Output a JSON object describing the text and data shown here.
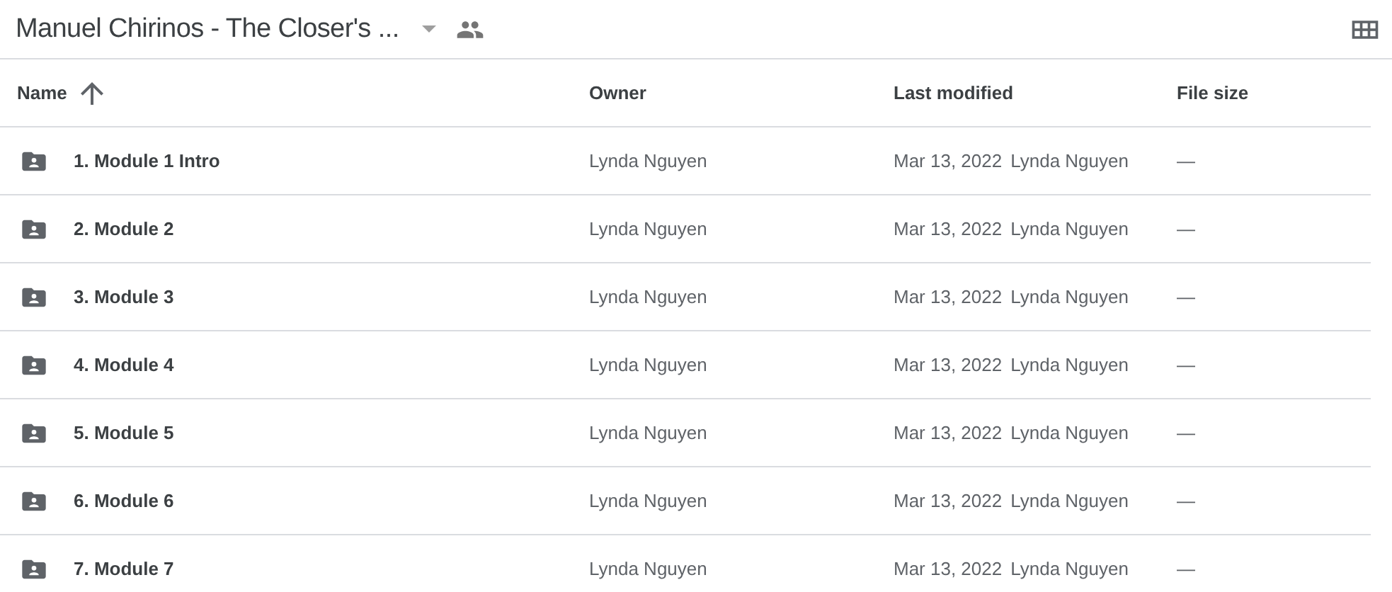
{
  "header": {
    "title": "Manuel Chirinos - The Closer's ..."
  },
  "table": {
    "columns": [
      {
        "label": "Name",
        "sorted": true
      },
      {
        "label": "Owner",
        "sorted": false
      },
      {
        "label": "Last modified",
        "sorted": false
      },
      {
        "label": "File size",
        "sorted": false
      }
    ],
    "rows": [
      {
        "name": "1. Module 1 Intro",
        "owner": "Lynda Nguyen",
        "modified_date": "Mar 13, 2022",
        "modified_by": "Lynda Nguyen",
        "size": "—"
      },
      {
        "name": "2. Module 2",
        "owner": "Lynda Nguyen",
        "modified_date": "Mar 13, 2022",
        "modified_by": "Lynda Nguyen",
        "size": "—"
      },
      {
        "name": "3. Module 3",
        "owner": "Lynda Nguyen",
        "modified_date": "Mar 13, 2022",
        "modified_by": "Lynda Nguyen",
        "size": "—"
      },
      {
        "name": "4. Module 4",
        "owner": "Lynda Nguyen",
        "modified_date": "Mar 13, 2022",
        "modified_by": "Lynda Nguyen",
        "size": "—"
      },
      {
        "name": "5. Module 5",
        "owner": "Lynda Nguyen",
        "modified_date": "Mar 13, 2022",
        "modified_by": "Lynda Nguyen",
        "size": "—"
      },
      {
        "name": "6. Module 6",
        "owner": "Lynda Nguyen",
        "modified_date": "Mar 13, 2022",
        "modified_by": "Lynda Nguyen",
        "size": "—"
      },
      {
        "name": "7. Module 7",
        "owner": "Lynda Nguyen",
        "modified_date": "Mar 13, 2022",
        "modified_by": "Lynda Nguyen",
        "size": "—"
      }
    ]
  }
}
